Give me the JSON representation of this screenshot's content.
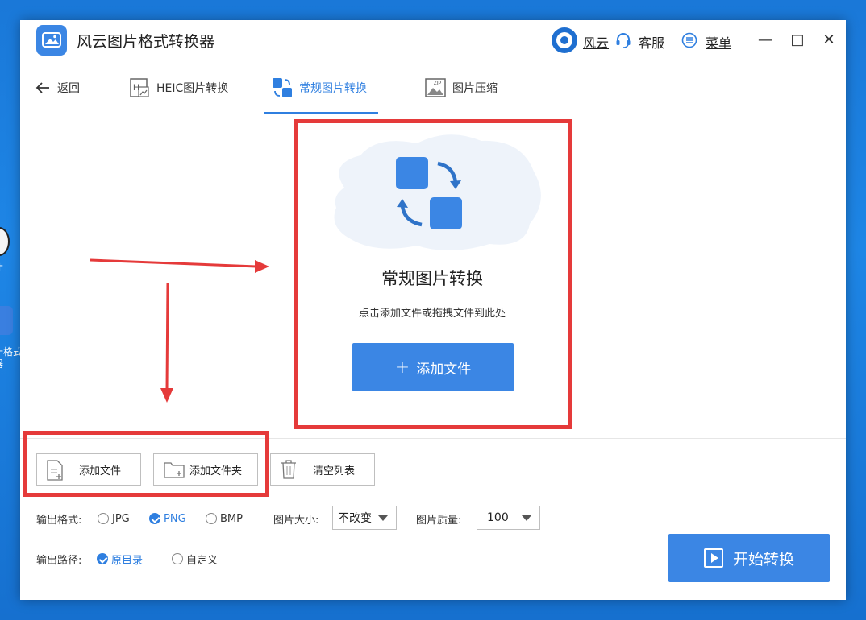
{
  "desktop": {
    "icon1_label": "才",
    "icon2_label_line1": "十格式",
    "icon2_label_line2": "器"
  },
  "window": {
    "title": "风云图片格式转换器",
    "user_name": "风云",
    "service_label": "客服",
    "menu_label": "菜单",
    "minimize_glyph": "—",
    "maximize_glyph": "□",
    "close_glyph": "✕"
  },
  "tabs": {
    "back_label": "返回",
    "items": [
      {
        "label": "HEIC图片转换",
        "icon": "heic-icon"
      },
      {
        "label": "常规图片转换",
        "icon": "convert-icon",
        "active": true
      },
      {
        "label": "图片压缩",
        "icon": "zip-image-icon"
      }
    ]
  },
  "dropzone": {
    "title": "常规图片转换",
    "hint": "点击添加文件或拖拽文件到此处",
    "add_button": "添加文件",
    "add_button_glyph": "+"
  },
  "toolbar": {
    "add_file": "添加文件",
    "add_folder": "添加文件夹",
    "clear_list": "清空列表"
  },
  "options": {
    "format_label": "输出格式:",
    "formats": [
      {
        "label": "JPG",
        "selected": false
      },
      {
        "label": "PNG",
        "selected": true
      },
      {
        "label": "BMP",
        "selected": false
      }
    ],
    "size_label": "图片大小:",
    "size_value": "不改变",
    "quality_label": "图片质量:",
    "quality_value": "100",
    "path_label": "输出路径:",
    "paths": [
      {
        "label": "原目录",
        "selected": true
      },
      {
        "label": "自定义",
        "selected": false
      }
    ]
  },
  "start_button": "开始转换",
  "colors": {
    "accent": "#3b86e4",
    "annotation_red": "#e53a3a"
  }
}
